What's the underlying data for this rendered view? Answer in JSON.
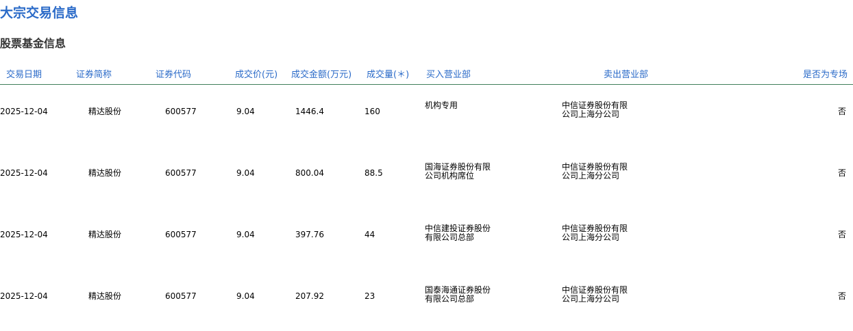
{
  "page": {
    "title": "大宗交易信息",
    "section_title": "股票基金信息"
  },
  "table": {
    "headers": [
      "交易日期",
      "证券简称",
      "证券代码",
      "成交价(元)",
      "成交金额(万元)",
      "成交量(＊)",
      "买入营业部",
      "卖出营业部",
      "是否为专场"
    ],
    "rows": [
      {
        "date": "2025-12-04",
        "name": "精达股份",
        "code": "600577",
        "price": "9.04",
        "amount": "1446.4",
        "volume": "160",
        "buyer_line1": "机构专用",
        "buyer_line2": "",
        "seller_line1": "中信证券股份有限",
        "seller_line2": "公司上海分公司",
        "special": "否"
      },
      {
        "date": "2025-12-04",
        "name": "精达股份",
        "code": "600577",
        "price": "9.04",
        "amount": "800.04",
        "volume": "88.5",
        "buyer_line1": "国海证券股份有限",
        "buyer_line2": "公司机构席位",
        "seller_line1": "中信证券股份有限",
        "seller_line2": "公司上海分公司",
        "special": "否"
      },
      {
        "date": "2025-12-04",
        "name": "精达股份",
        "code": "600577",
        "price": "9.04",
        "amount": "397.76",
        "volume": "44",
        "buyer_line1": "中信建投证券股份",
        "buyer_line2": "有限公司总部",
        "seller_line1": "中信证券股份有限",
        "seller_line2": "公司上海分公司",
        "special": "否"
      },
      {
        "date": "2025-12-04",
        "name": "精达股份",
        "code": "600577",
        "price": "9.04",
        "amount": "207.92",
        "volume": "23",
        "buyer_line1": "国泰海通证券股份",
        "buyer_line2": "有限公司总部",
        "seller_line1": "中信证券股份有限",
        "seller_line2": "公司上海分公司",
        "special": "否"
      }
    ]
  },
  "colors": {
    "header_text": "#2a6ac8",
    "title_text": "#2a6ac8",
    "section_text": "#333333",
    "header_border": "#3f7f5a"
  }
}
